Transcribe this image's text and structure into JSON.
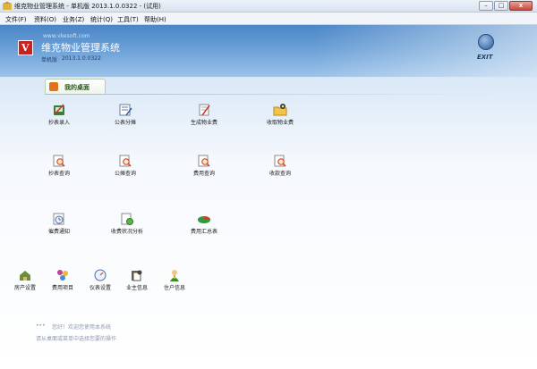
{
  "window": {
    "title": "维克物业管理系统 - 单机版 2013.1.0.0322 - (试用)",
    "min_label": "–",
    "max_label": "□",
    "close_label": "x"
  },
  "menu": [
    {
      "label": "文件(F)"
    },
    {
      "label": "资料(O)"
    },
    {
      "label": "业务(Z)"
    },
    {
      "label": "统计(Q)"
    },
    {
      "label": "工具(T)"
    },
    {
      "label": "帮助(H)"
    }
  ],
  "header": {
    "logo_letter": "V",
    "url": "www.vkesoft.com",
    "app_name": "维克物业管理系统",
    "edition": "单机版",
    "version": "2013.1.0.0322",
    "exit_label": "EXIT"
  },
  "tab": {
    "label": "我的桌面"
  },
  "functions": [
    {
      "label": "抄表录入",
      "icon": "meter-entry-icon"
    },
    {
      "label": "公表分摊",
      "icon": "allocation-icon"
    },
    {
      "label": "生成物业费",
      "icon": "generate-fee-icon"
    },
    {
      "label": "收取物业费",
      "icon": "collect-fee-icon"
    },
    {
      "label": "抄表查询",
      "icon": "meter-query-icon"
    },
    {
      "label": "公摊查询",
      "icon": "allocation-query-icon"
    },
    {
      "label": "费用查询",
      "icon": "fee-query-icon"
    },
    {
      "label": "收款查询",
      "icon": "payment-query-icon"
    },
    {
      "label": "催费通知",
      "icon": "reminder-icon"
    },
    {
      "label": "收费状况分析",
      "icon": "analysis-icon"
    },
    {
      "label": "费用汇总表",
      "icon": "summary-chart-icon"
    }
  ],
  "settings": [
    {
      "label": "房产设置",
      "icon": "property-icon"
    },
    {
      "label": "费用项目",
      "icon": "fee-items-icon"
    },
    {
      "label": "仪表设置",
      "icon": "meter-settings-icon"
    },
    {
      "label": "业主信息",
      "icon": "owner-info-icon"
    },
    {
      "label": "住户信息",
      "icon": "resident-info-icon"
    }
  ],
  "tips": {
    "line1": "您好！欢迎您使用本系统",
    "line1_prefix": "•••",
    "line2": "请从桌面或菜单中选择您要的操作"
  },
  "colors": {
    "banner_top": "#4a86c7",
    "logo_red": "#c8221e",
    "tab_green": "#2c5a1c",
    "tab_icon_orange": "#e0731a"
  }
}
